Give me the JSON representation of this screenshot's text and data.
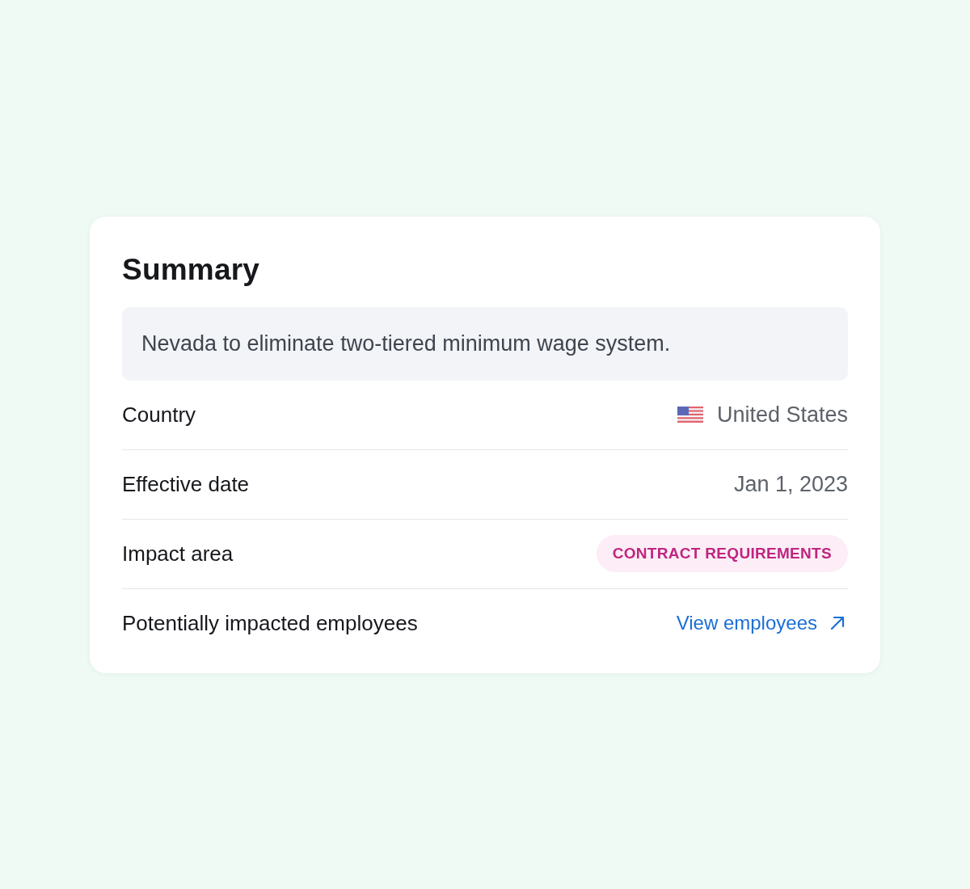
{
  "card": {
    "title": "Summary",
    "summary": "Nevada to eliminate two-tiered minimum wage system."
  },
  "rows": [
    {
      "kind": "country",
      "label": "Country",
      "value": "United States"
    },
    {
      "kind": "text",
      "label": "Effective date",
      "value": "Jan 1, 2023"
    },
    {
      "kind": "badge",
      "label": "Impact area",
      "value": "CONTRACT REQUIREMENTS"
    },
    {
      "kind": "link",
      "label": "Potentially impacted employees",
      "value": "View employees"
    }
  ]
}
